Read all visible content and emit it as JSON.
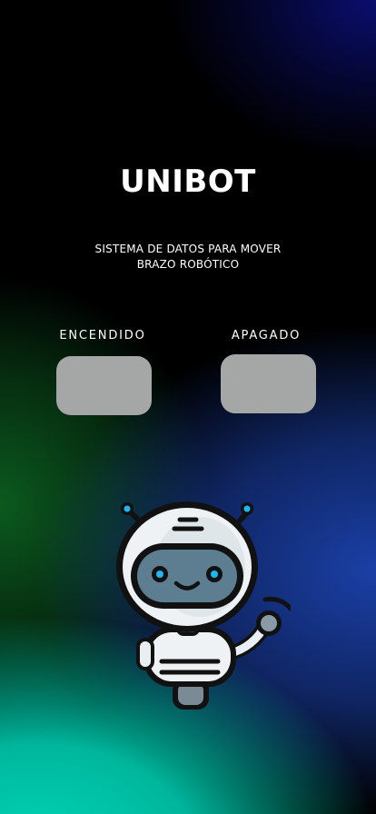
{
  "app": {
    "title": "UNIBOT",
    "subtitle_line1": "SISTEMA DE DATOS PARA MOVER",
    "subtitle_line2": "BRAZO ROBÓTICO"
  },
  "controls": {
    "on_label": "ENCENDIDO",
    "off_label": "APAGADO"
  },
  "illustration": {
    "icon": "robot-waving-icon"
  },
  "colors": {
    "button": "#a5a6a6",
    "accent": "#1fb6f5"
  }
}
